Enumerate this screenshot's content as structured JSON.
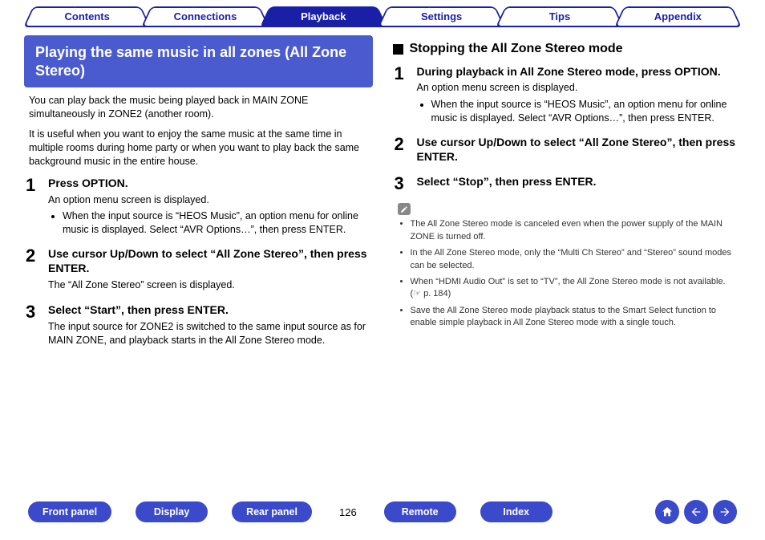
{
  "nav_tabs": [
    {
      "label": "Contents",
      "active": false
    },
    {
      "label": "Connections",
      "active": false
    },
    {
      "label": "Playback",
      "active": true
    },
    {
      "label": "Settings",
      "active": false
    },
    {
      "label": "Tips",
      "active": false
    },
    {
      "label": "Appendix",
      "active": false
    }
  ],
  "left": {
    "section_title": "Playing the same music in all zones (All Zone Stereo)",
    "intro1": "You can play back the music being played back in MAIN ZONE simultaneously in ZONE2 (another room).",
    "intro2": "It is useful when you want to enjoy the same music at the same time in multiple rooms during home party or when you want to play back the same background music in the entire house.",
    "steps": [
      {
        "num": "1",
        "title": "Press OPTION.",
        "desc": "An option menu screen is displayed.",
        "bullets": [
          "When the input source is “HEOS Music”, an option menu for online music is displayed. Select “AVR Options…”, then press ENTER."
        ]
      },
      {
        "num": "2",
        "title": "Use cursor Up/Down to select “All Zone Stereo”, then press ENTER.",
        "desc": "The “All Zone Stereo” screen is displayed.",
        "bullets": []
      },
      {
        "num": "3",
        "title": "Select “Start”, then press ENTER.",
        "desc": "The input source for ZONE2 is switched to the same input source as for MAIN ZONE, and playback starts in the All Zone Stereo mode.",
        "bullets": []
      }
    ]
  },
  "right": {
    "subheading": "Stopping the All Zone Stereo mode",
    "steps": [
      {
        "num": "1",
        "title": "During playback in All Zone Stereo mode, press OPTION.",
        "desc": "An option menu screen is displayed.",
        "bullets": [
          "When the input source is “HEOS Music”, an option menu for online music is displayed. Select “AVR Options…”, then press ENTER."
        ]
      },
      {
        "num": "2",
        "title": "Use cursor Up/Down to select “All Zone Stereo”, then press ENTER.",
        "desc": "",
        "bullets": []
      },
      {
        "num": "3",
        "title": "Select “Stop”, then press ENTER.",
        "desc": "",
        "bullets": []
      }
    ],
    "notes": [
      "The All Zone Stereo mode is canceled even when the power supply of the MAIN ZONE is turned off.",
      "In the All Zone Stereo mode, only the “Multi Ch Stereo” and “Stereo” sound modes can be selected.",
      "When “HDMI Audio Out” is set to “TV”, the All Zone Stereo mode is not available. (☞ p. 184)",
      "Save the All Zone Stereo mode playback status to the Smart Select function to enable simple playback in All Zone Stereo mode with a single touch."
    ]
  },
  "bottom": {
    "buttons": [
      "Front panel",
      "Display",
      "Rear panel",
      "Remote",
      "Index"
    ],
    "page_number": "126"
  }
}
